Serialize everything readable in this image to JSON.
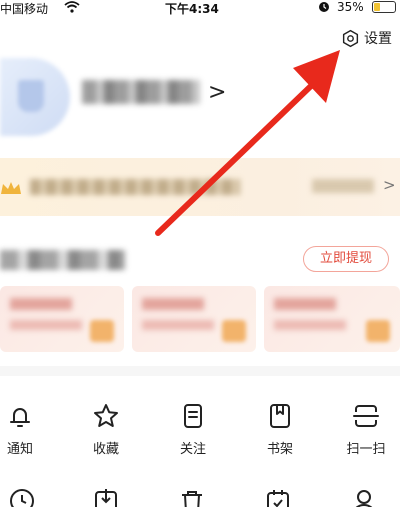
{
  "status_bar": {
    "carrier": "中国移动",
    "time": "下午4:34",
    "battery_percent": "35%",
    "battery_level": 0.35,
    "battery_color": "#f2c433"
  },
  "header": {
    "settings_label": "设置",
    "settings_icon": "gear-icon"
  },
  "profile": {
    "chevron": ">",
    "username_blurred": true
  },
  "vip_banner": {
    "chevron": ">",
    "background": "#fdf1dc"
  },
  "earnings": {
    "withdraw_label": "立即提现",
    "accent": "#e24a3b"
  },
  "menu_row1": [
    {
      "label": "通知",
      "icon": "bell-icon"
    },
    {
      "label": "收藏",
      "icon": "star-icon"
    },
    {
      "label": "关注",
      "icon": "follow-list-icon"
    },
    {
      "label": "书架",
      "icon": "bookshelf-icon"
    },
    {
      "label": "扫一扫",
      "icon": "scan-icon"
    }
  ],
  "menu_row2_icons": [
    "clock-icon",
    "download-icon",
    "trash-icon",
    "calendar-icon",
    "user-icon"
  ],
  "annotation_arrow_color": "#e8291c"
}
